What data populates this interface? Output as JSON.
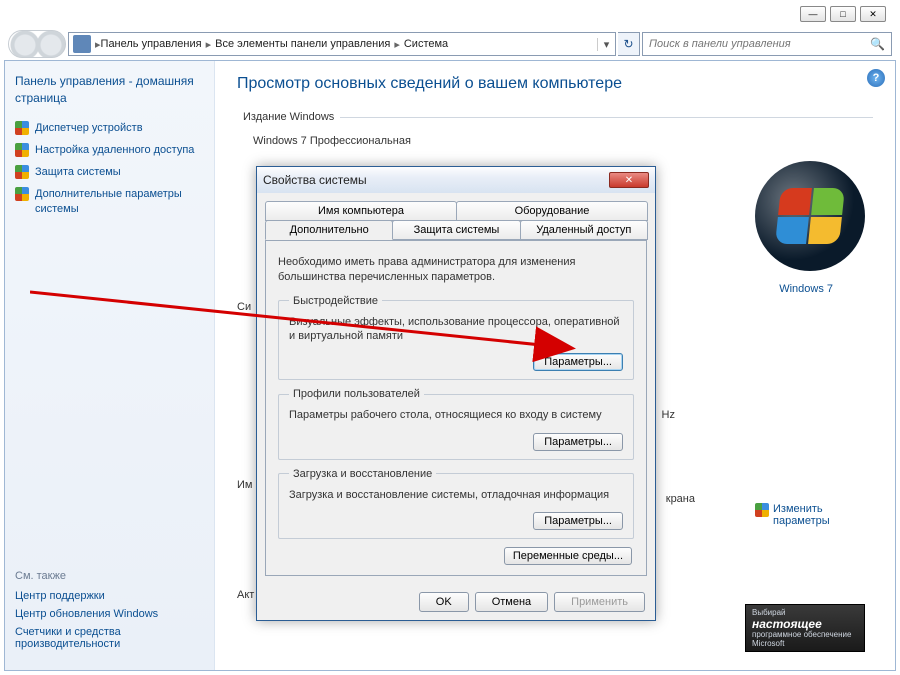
{
  "breadcrumbs": [
    "Панель управления",
    "Все элементы панели управления",
    "Система"
  ],
  "search_placeholder": "Поиск в панели управления",
  "sidebar": {
    "home": "Панель управления - домашняя страница",
    "links": [
      "Диспетчер устройств",
      "Настройка удаленного доступа",
      "Защита системы",
      "Дополнительные параметры системы"
    ],
    "see_also_title": "См. также",
    "see_also": [
      "Центр поддержки",
      "Центр обновления Windows",
      "Счетчики и средства производительности"
    ]
  },
  "content": {
    "title": "Просмотр основных сведений о вашем компьютере",
    "edition_legend": "Издание Windows",
    "edition_name": "Windows 7 Профессиональная",
    "brand": "Windows 7",
    "hz_suffix": "Hz",
    "screen_suffix": "крана",
    "system_label": "Си",
    "name_label": "Им",
    "activation_label": "Акт",
    "change_link": "Изменить параметры"
  },
  "genuine": {
    "top": "Выбирай",
    "main": "настоящее",
    "sub": "программное обеспечение",
    "brand": "Microsoft"
  },
  "dialog": {
    "title": "Свойства системы",
    "tabs_row1": [
      "Имя компьютера",
      "Оборудование"
    ],
    "tabs_row2": [
      "Дополнительно",
      "Защита системы",
      "Удаленный доступ"
    ],
    "admin_note": "Необходимо иметь права администратора для изменения большинства перечисленных параметров.",
    "groups": [
      {
        "legend": "Быстродействие",
        "desc": "Визуальные эффекты, использование процессора, оперативной и виртуальной памяти",
        "btn": "Параметры..."
      },
      {
        "legend": "Профили пользователей",
        "desc": "Параметры рабочего стола, относящиеся ко входу в систему",
        "btn": "Параметры..."
      },
      {
        "legend": "Загрузка и восстановление",
        "desc": "Загрузка и восстановление системы, отладочная информация",
        "btn": "Параметры..."
      }
    ],
    "env_button": "Переменные среды...",
    "ok": "OK",
    "cancel": "Отмена",
    "apply": "Применить"
  }
}
